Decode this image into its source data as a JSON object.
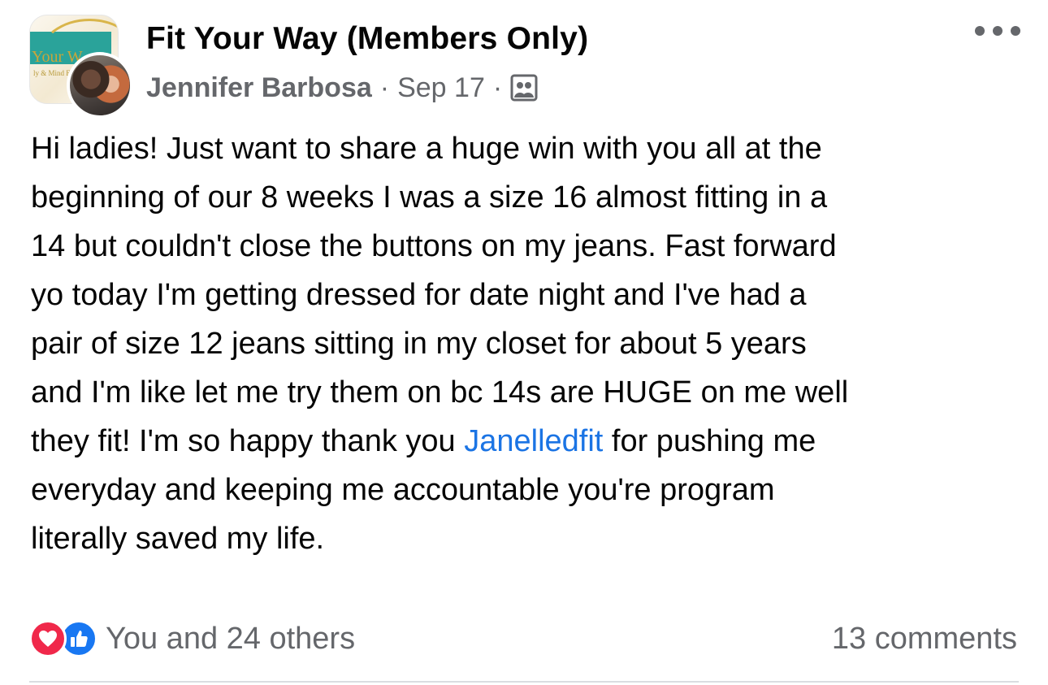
{
  "header": {
    "group_name": "Fit Your Way (Members Only)",
    "author": "Jennifer Barbosa",
    "separator": "·",
    "date": "Sep 17",
    "audience_icon": "group-members-icon",
    "more_icon": "more-options-icon"
  },
  "group_avatar": {
    "brand_text": "Your W",
    "brand_subtext": "ly & Mind F"
  },
  "post": {
    "lines": [
      "Hi ladies! Just want to share a huge win with you all at the",
      "beginning of our 8 weeks I was a size 16 almost fitting in a",
      "14 but couldn't close the buttons on my jeans. Fast forward",
      "yo today I'm getting dressed for date night and I've had a",
      "pair of size 12 jeans sitting in my closet for about 5 years",
      "and I'm like let me try them on bc 14s are HUGE on me well"
    ],
    "line7_before": "they fit! I'm so happy thank you ",
    "mention": "Janelledfit",
    "line7_after": " for pushing me",
    "line8": "everyday and keeping me accountable you're program",
    "line9": "literally saved my life."
  },
  "footer": {
    "reaction_icons": [
      "love-icon",
      "like-icon"
    ],
    "reaction_summary": "You and 24 others",
    "comments": "13 comments"
  },
  "colors": {
    "text": "#050505",
    "meta": "#65676b",
    "mention": "#1b74e4",
    "love": "#f0284a",
    "like": "#1877f2",
    "divider": "#dadde1"
  }
}
